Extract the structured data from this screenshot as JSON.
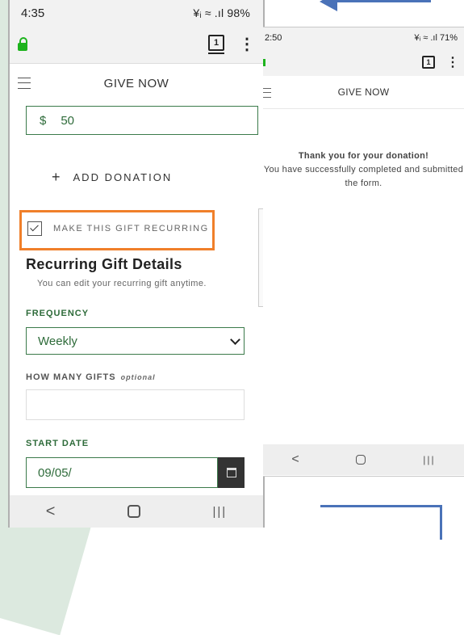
{
  "left_phone": {
    "status": {
      "time": "4:35",
      "icons": "¥ᵢ ≈ .ıl 98%"
    },
    "browser": {
      "tab_count": "1"
    },
    "header": {
      "title": "GIVE NOW"
    },
    "form": {
      "amount": {
        "currency": "$",
        "value": "50"
      },
      "add_donation": "ADD DONATION",
      "recurring_checkbox": {
        "label": "MAKE THIS GIFT RECURRING",
        "checked": true
      },
      "section_title": "Recurring Gift Details",
      "section_subtitle": "You can edit your recurring gift anytime.",
      "frequency": {
        "label": "FREQUENCY",
        "value": "Weekly"
      },
      "how_many": {
        "label": "HOW MANY GIFTS",
        "optional": "optional",
        "value": ""
      },
      "start_date": {
        "label": "START DATE",
        "value": "09/05/"
      }
    }
  },
  "right_phone": {
    "status": {
      "time": "2:50",
      "icons": "¥ᵢ ≈ .ıl 71%"
    },
    "browser": {
      "tab_count": "1"
    },
    "header": {
      "title": "GIVE NOW"
    },
    "message": {
      "heading": "Thank you for your donation!",
      "body": "You have successfully completed and submitted the form."
    }
  },
  "colors": {
    "accent_green": "#2e6b3a",
    "highlight_orange": "#f07f2a",
    "annotation_blue": "#4a72b8"
  }
}
